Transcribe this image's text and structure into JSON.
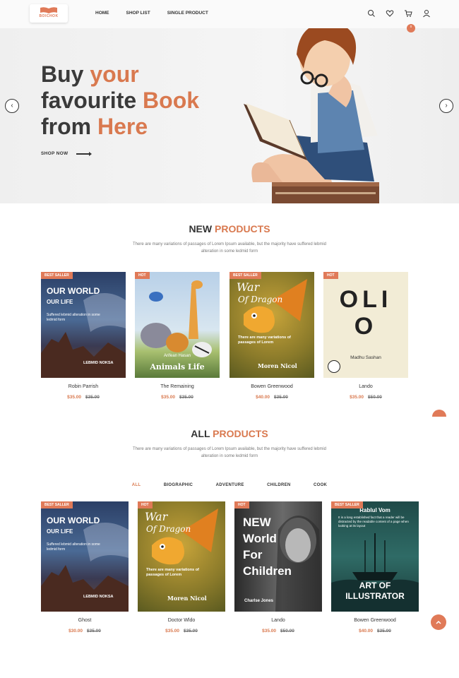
{
  "header": {
    "logo_text": "BOICHOK",
    "nav": [
      "HOME",
      "SHOP LIST",
      "SINGLE PRODUCT"
    ],
    "cart_count": "0"
  },
  "hero": {
    "line1_a": "Buy ",
    "line1_b": "your",
    "line2_a": "favourite ",
    "line2_b": "Book",
    "line3_a": "from ",
    "line3_b": "Here",
    "cta": "SHOP NOW"
  },
  "new_products": {
    "title_a": "NEW ",
    "title_b": "PRODUCTS",
    "subtitle": "There are many variations of passages of Lorem Ipsum available, but the majority have suffered lebmid alteration in some ledmid form",
    "items": [
      {
        "tag": "BEST SALLER",
        "name": "Robin Parrish",
        "price": "$35.00",
        "old_price": "$35.00",
        "cover_title": "OUR WORLD",
        "cover_sub": "OUR LIFE",
        "cover_blurb": "Suffered lebmid alteration in some ledmid form",
        "cover_author": "LEBMID NOKSA"
      },
      {
        "tag": "HOT",
        "name": "The Remaining",
        "price": "$35.00",
        "old_price": "$35.00",
        "cover_author": "Arifean Hasan",
        "cover_title": "Animals Life"
      },
      {
        "tag": "BEST SALLER",
        "name": "Bowen Greenwood",
        "price": "$40.00",
        "old_price": "$35.00",
        "cover_title": "War",
        "cover_sub": "Of Dragon",
        "cover_blurb": "There are many variations of passages of Lorem",
        "cover_author": "Moren Nicol"
      },
      {
        "tag": "HOT",
        "name": "Lando",
        "price": "$35.00",
        "old_price": "$50.00",
        "cover_title": "OLIO",
        "cover_author": "Madhu Sashan"
      }
    ]
  },
  "all_products": {
    "title_a": "ALL ",
    "title_b": "PRODUCTS",
    "subtitle": "There are many variations of passages of Lorem Ipsum available, but the majority have suffered lebmid alteration in some ledmid form",
    "filters": [
      "ALL",
      "BIOGRAPHIC",
      "ADVENTURE",
      "CHILDREN",
      "COOK"
    ],
    "items": [
      {
        "tag": "BEST SALLER",
        "name": "Ghost",
        "price": "$30.00",
        "old_price": "$35.00",
        "cover_title": "OUR WORLD",
        "cover_sub": "OUR LIFE",
        "cover_blurb": "Suffered lebmid alteration in some ledmid form",
        "cover_author": "LEBMID NOKSA"
      },
      {
        "tag": "HOT",
        "name": "Doctor Wldo",
        "price": "$35.00",
        "old_price": "$35.00",
        "cover_title": "War",
        "cover_sub": "Of Dragon",
        "cover_blurb": "There are many variations of passages of Lorem",
        "cover_author": "Moren Nicol"
      },
      {
        "tag": "HOT",
        "name": "Lando",
        "price": "$35.00",
        "old_price": "$50.00",
        "cover_title": "NEW World For Children",
        "cover_author": "Charlse Jones"
      },
      {
        "tag": "BEST SALLER",
        "name": "Bowen Greenwood",
        "price": "$40.00",
        "old_price": "$35.00",
        "cover_author": "Rablul Vom",
        "cover_blurb": "It is a long established fact that a reader will be distracted by the readable content of a page when looking at its layout",
        "cover_title": "ART OF ILLUSTRATOR"
      }
    ]
  },
  "colors": {
    "accent": "#d9794f",
    "text": "#333333"
  }
}
